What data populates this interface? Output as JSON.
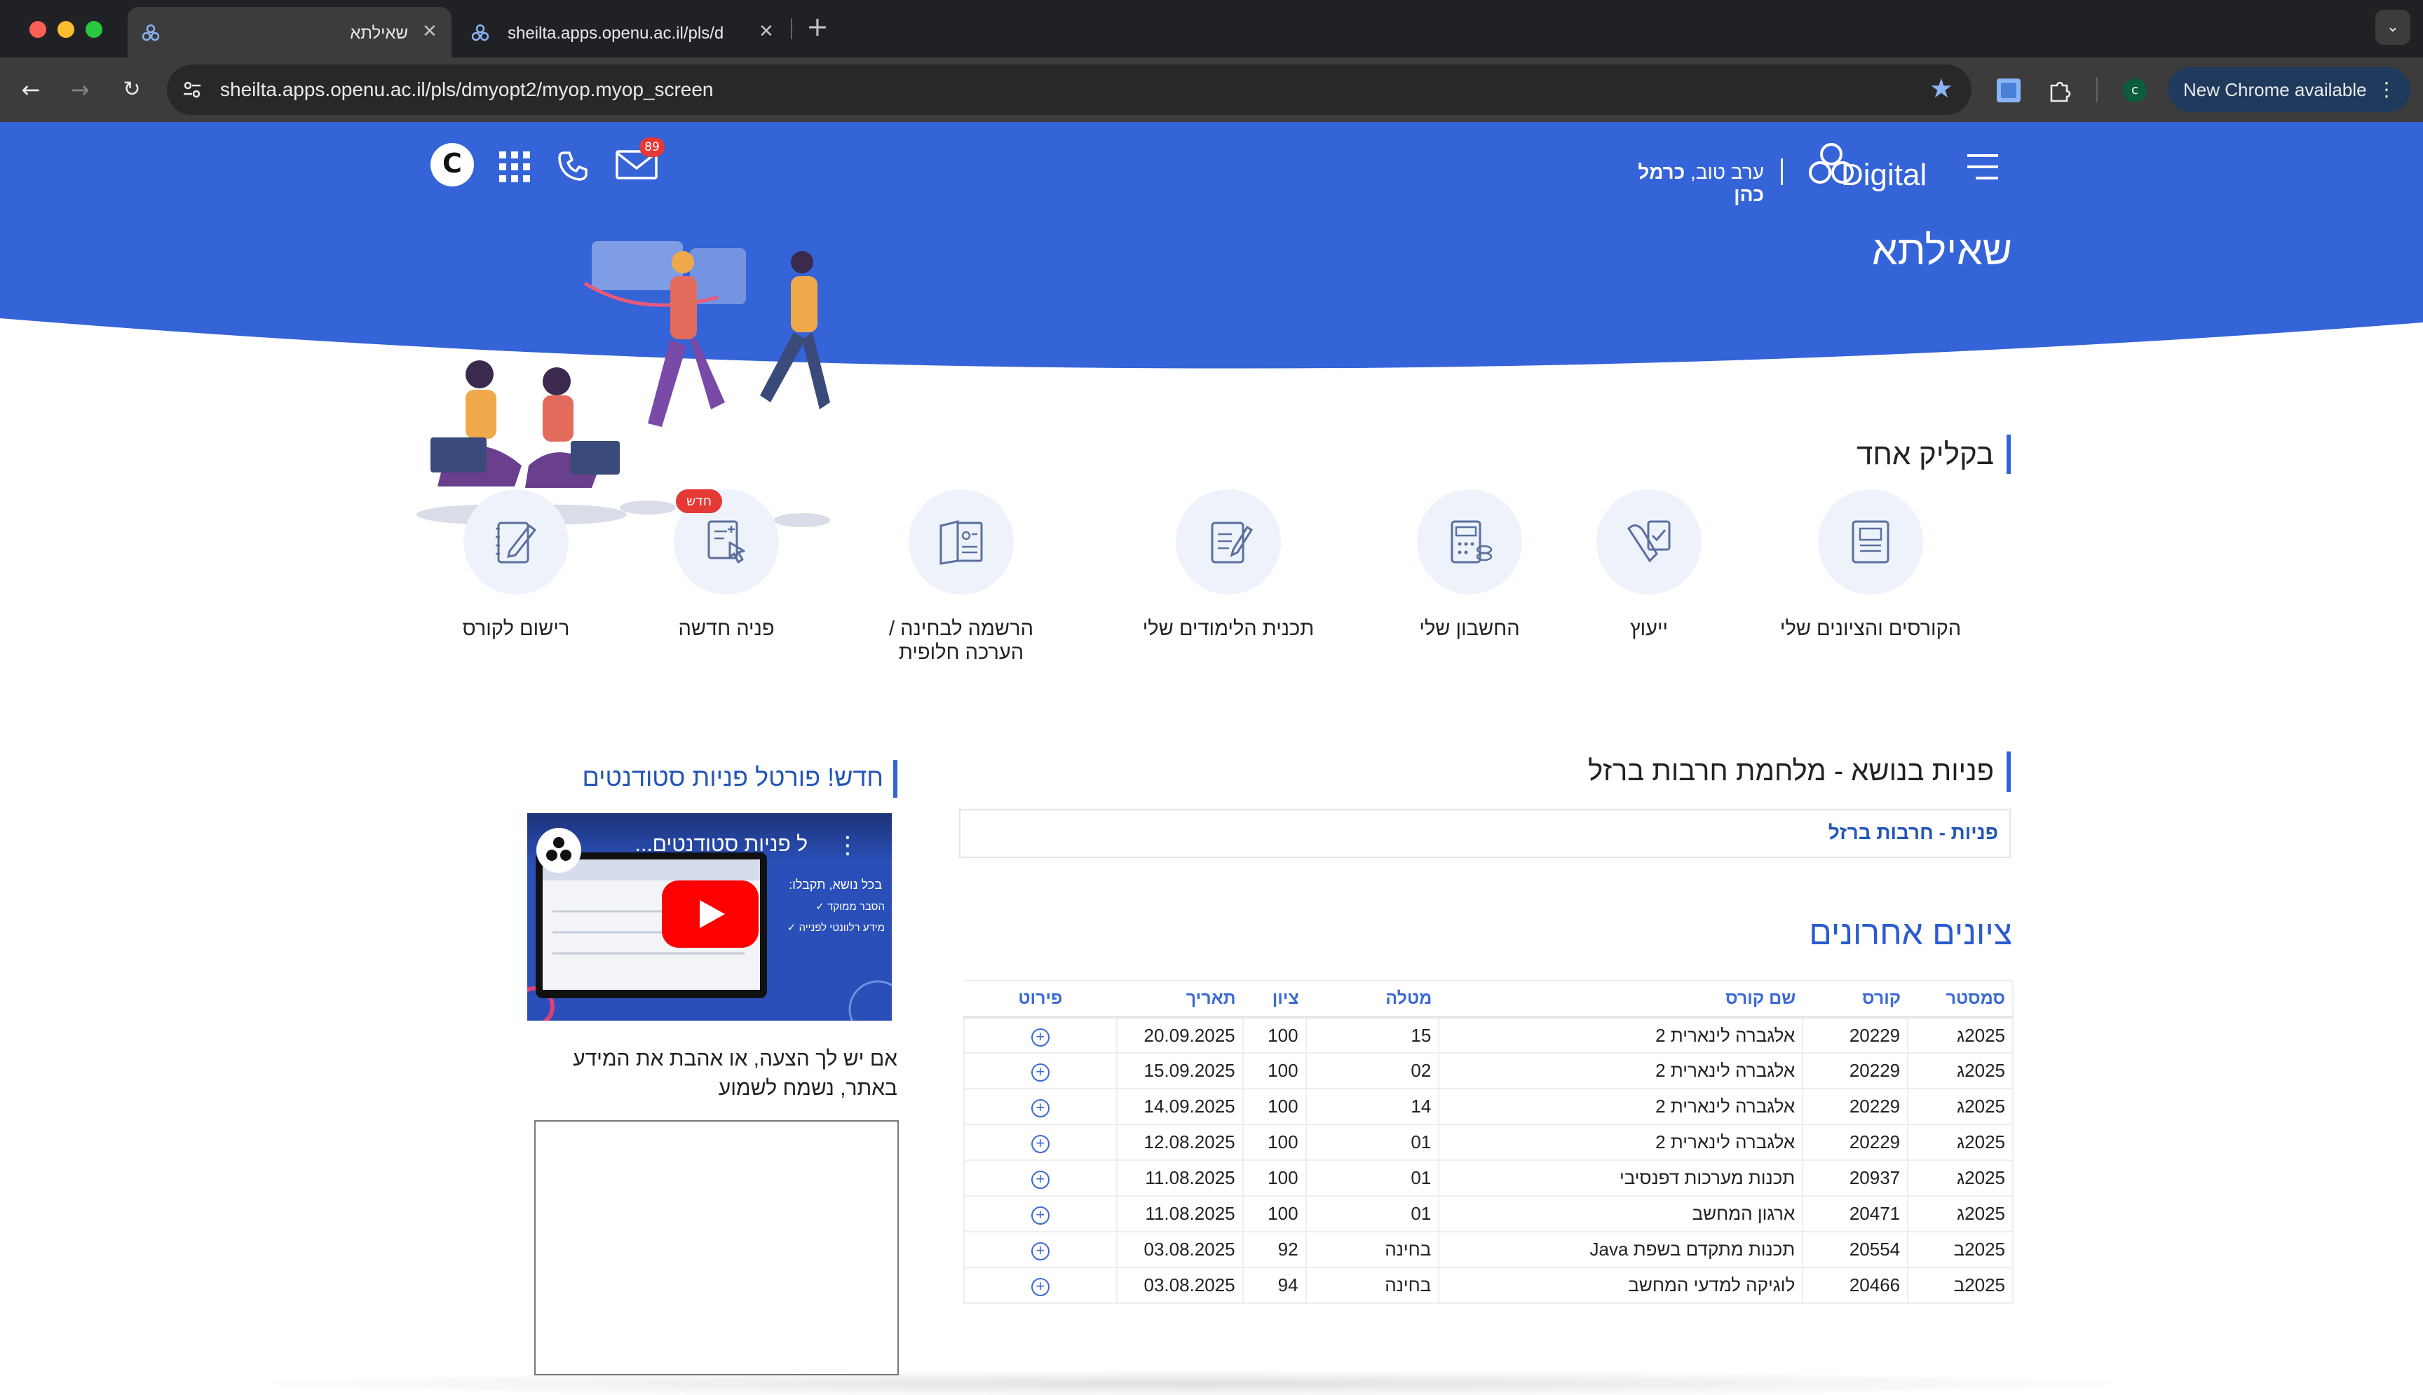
{
  "browser": {
    "tabs": [
      {
        "title": "שאילתא",
        "active": true
      },
      {
        "title": "sheilta.apps.openu.ac.il/pls/d",
        "active": false
      }
    ],
    "url": "sheilta.apps.openu.ac.il/pls/dmyopt2/myop.myop_screen",
    "profile_initial": "c",
    "update_label": "New Chrome available"
  },
  "header": {
    "logo_text": "Digital",
    "greeting_prefix": "ערב טוב,",
    "user_name": "כרמל כהן",
    "page_title": "שאילתא",
    "mail_count": "89",
    "c_button": "C",
    "brand_color": "#3563d8"
  },
  "quick_links": {
    "title": "בקליק אחד",
    "items": [
      {
        "label": "הקורסים והציונים שלי",
        "icon": "book-icon"
      },
      {
        "label": "ייעוץ",
        "icon": "consult-icon"
      },
      {
        "label": "החשבון שלי",
        "icon": "calculator-icon"
      },
      {
        "label": "תכנית הלימודים שלי",
        "icon": "study-plan-icon"
      },
      {
        "label": "הרשמה לבחינה / הערכה חלופית",
        "icon": "exam-register-icon"
      },
      {
        "label": "פניה חדשה",
        "icon": "new-request-icon",
        "badge": "חדש"
      },
      {
        "label": "רישום לקורס",
        "icon": "course-register-icon"
      }
    ]
  },
  "topic": {
    "title": "פניות בנושא - מלחמת חרבות ברזל",
    "link": "פניות - חרבות ברזל"
  },
  "grades": {
    "title": "ציונים אחרונים",
    "columns": [
      "סמסטר",
      "קורס",
      "שם קורס",
      "מטלה",
      "ציון",
      "תאריך",
      "פירוט"
    ],
    "rows": [
      {
        "semester": "2025ג",
        "course": "20229",
        "name": "אלגברה לינארית 2",
        "task": "15",
        "grade": "100",
        "date": "20.09.2025"
      },
      {
        "semester": "2025ג",
        "course": "20229",
        "name": "אלגברה לינארית 2",
        "task": "02",
        "grade": "100",
        "date": "15.09.2025"
      },
      {
        "semester": "2025ג",
        "course": "20229",
        "name": "אלגברה לינארית 2",
        "task": "14",
        "grade": "100",
        "date": "14.09.2025"
      },
      {
        "semester": "2025ג",
        "course": "20229",
        "name": "אלגברה לינארית 2",
        "task": "01",
        "grade": "100",
        "date": "12.08.2025"
      },
      {
        "semester": "2025ג",
        "course": "20937",
        "name": "תכנות מערכות דפנסיבי",
        "task": "01",
        "grade": "100",
        "date": "11.08.2025"
      },
      {
        "semester": "2025ג",
        "course": "20471",
        "name": "ארגון המחשב",
        "task": "01",
        "grade": "100",
        "date": "11.08.2025"
      },
      {
        "semester": "2025ב",
        "course": "20554",
        "name": "תכנות מתקדם בשפת Java",
        "task": "בחינה",
        "grade": "92",
        "date": "03.08.2025"
      },
      {
        "semester": "2025ב",
        "course": "20466",
        "name": "לוגיקה למדעי המחשב",
        "task": "בחינה",
        "grade": "94",
        "date": "03.08.2025"
      }
    ]
  },
  "portal": {
    "title": "חדש! פורטל פניות סטודנטים",
    "video_title": "ל פניות סטודנטים...",
    "video_subtitle": "בכל נושא, תקבלו:",
    "video_bullets": [
      "הסבר ממוקד",
      "מידע רלוונטי לפנייה"
    ],
    "feedback_text": "אם יש לך הצעה, או אהבת את המידע באתר, נשמח לשמוע"
  }
}
